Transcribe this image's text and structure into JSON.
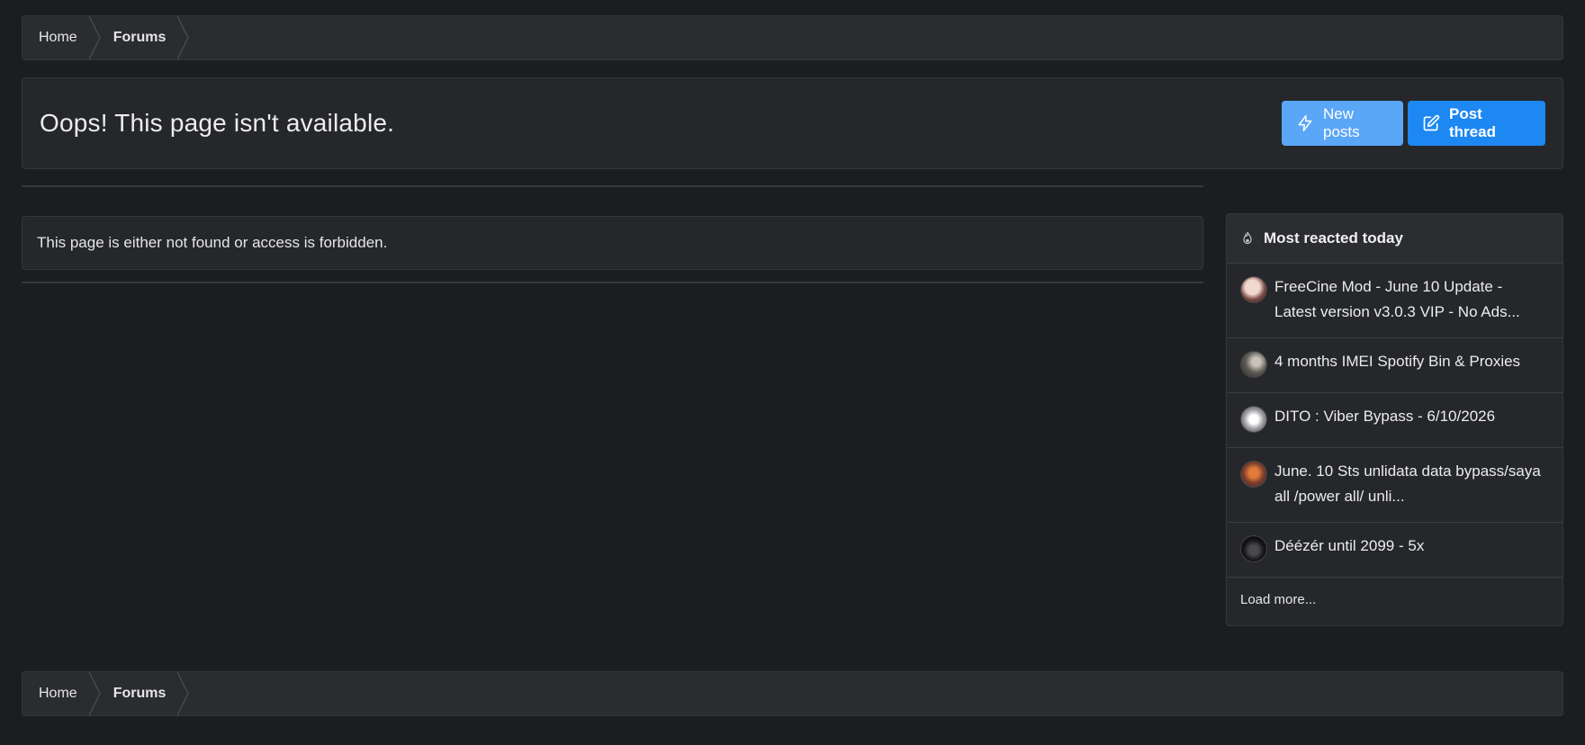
{
  "breadcrumb": {
    "items": [
      {
        "label": "Home"
      },
      {
        "label": "Forums"
      }
    ]
  },
  "header": {
    "title": "Oops! This page isn't available.",
    "buttons": {
      "new_posts": "New posts",
      "post_thread": "Post thread"
    }
  },
  "message": {
    "text": "This page is either not found or access is forbidden."
  },
  "widget": {
    "title": "Most reacted today",
    "items": [
      {
        "title": "FreeCine Mod - June 10 Update - Latest version v3.0.3 VIP - No Ads..."
      },
      {
        "title": "4 months IMEI Spotify Bin & Proxies"
      },
      {
        "title": "DITO : Viber Bypass - 6/10/2026"
      },
      {
        "title": "June. 10 Sts unlidata data bypass/saya all /power all/ unli..."
      },
      {
        "title": "Déézér until 2099 - 5x"
      }
    ],
    "load_more": "Load more..."
  },
  "colors": {
    "background": "#1c1d1f",
    "panel": "#25272a",
    "breadcrumb": "#2a2c2f",
    "new_posts_button": "#5aa6f7",
    "post_thread_button": "#1d87f2"
  }
}
